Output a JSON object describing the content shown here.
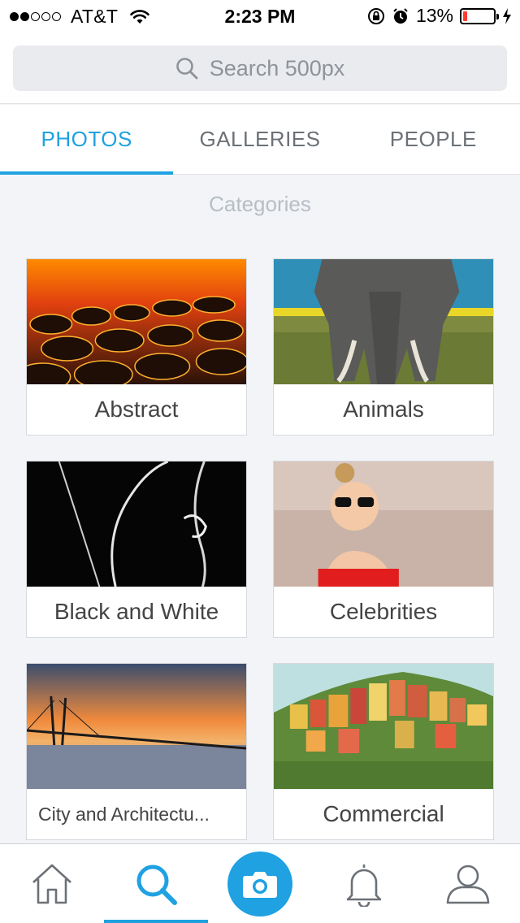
{
  "status_bar": {
    "carrier": "AT&T",
    "time": "2:23 PM",
    "battery_percent": "13%",
    "battery_level": 0.13,
    "signal_bars_filled": 2,
    "signal_bars_total": 5
  },
  "search": {
    "placeholder": "Search 500px"
  },
  "tabs": [
    {
      "label": "PHOTOS",
      "active": true
    },
    {
      "label": "GALLERIES",
      "active": false
    },
    {
      "label": "PEOPLE",
      "active": false
    }
  ],
  "section_title": "Categories",
  "categories": [
    {
      "label": "Abstract",
      "image": "glowing-pebbles"
    },
    {
      "label": "Animals",
      "image": "elephant"
    },
    {
      "label": "Black and White",
      "image": "silhouette-figure"
    },
    {
      "label": "Celebrities",
      "image": "woman-sunglasses-laughing"
    },
    {
      "label": "City and Architectu...",
      "image": "bridge-sunset"
    },
    {
      "label": "Commercial",
      "image": "colorful-hillside-village"
    }
  ],
  "bottom_nav": [
    {
      "icon": "home-icon",
      "active": false
    },
    {
      "icon": "search-icon",
      "active": true
    },
    {
      "icon": "camera-icon",
      "active": false
    },
    {
      "icon": "bell-icon",
      "active": false
    },
    {
      "icon": "profile-icon",
      "active": false
    }
  ],
  "colors": {
    "accent": "#1fa1e2",
    "background": "#f2f4f7",
    "battery_low": "#ff3b30"
  }
}
